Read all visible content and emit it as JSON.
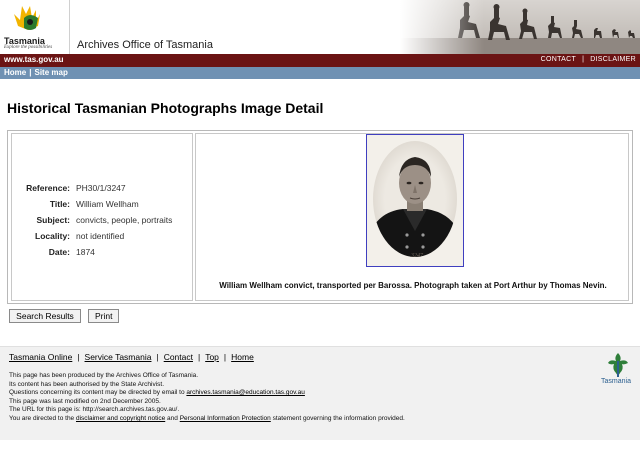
{
  "header": {
    "logo_name": "Tasmania",
    "logo_tagline": "Explore the possibilities",
    "site_title": "Archives Office of Tasmania"
  },
  "redbar": {
    "url": "www.tas.gov.au",
    "contact": "CONTACT",
    "separator": "|",
    "disclaimer": "DISCLAIMER"
  },
  "nav": {
    "home": "Home",
    "separator": "|",
    "sitemap": "Site map"
  },
  "page_title": "Historical Tasmanian Photographs Image Detail",
  "details": [
    {
      "key": "Reference:",
      "value": "PH30/1/3247"
    },
    {
      "key": "Title:",
      "value": "William Wellham"
    },
    {
      "key": "Subject:",
      "value": "convicts, people, portraits"
    },
    {
      "key": "Locality:",
      "value": "not identified"
    },
    {
      "key": "Date:",
      "value": "1874"
    }
  ],
  "photo_inscription": "3247",
  "caption": "William Wellham convict, transported per Barossa. Photograph taken at Port Arthur by Thomas Nevin.",
  "buttons": {
    "search_results": "Search Results",
    "print": "Print"
  },
  "footer": {
    "links": [
      "Tasmania Online",
      "Service Tasmania",
      "Contact",
      "Top",
      "Home"
    ],
    "separator": "|",
    "line1": "This page has been produced by the Archives Office of Tasmania.",
    "line2": "Its content has been authorised by the State Archivist.",
    "line3_prefix": "Questions concerning its content may be directed by email to",
    "line3_email": "archives.tasmania@education.tas.gov.au",
    "line4": "This page was last modified on 2nd December 2005.",
    "line5": "The URL for this page is: http://search.archives.tas.gov.au/.",
    "line6_prefix": "You are directed to the",
    "line6_link1": "disclaimer and copyright notice",
    "line6_and": "and",
    "line6_link2": "Personal Information Protection",
    "line6_suffix": "statement governing the information provided.",
    "logo_word": "Tasmania"
  },
  "colors": {
    "redbar": "#6b1414",
    "bluebar": "#6f91b3",
    "photo_border": "#3f3fbf"
  }
}
